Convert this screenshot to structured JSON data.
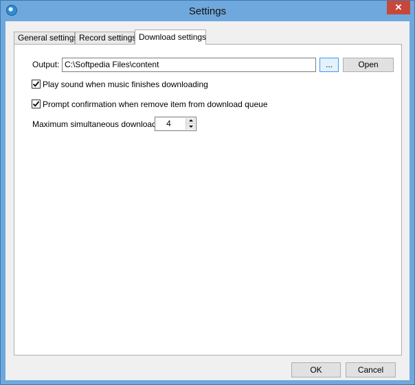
{
  "window": {
    "title": "Settings",
    "close_symbol": "✕",
    "app_icon": "app-logo-icon"
  },
  "tabs": [
    {
      "label": "General settings",
      "active": false
    },
    {
      "label": "Record settings",
      "active": false
    },
    {
      "label": "Download settings",
      "active": true
    }
  ],
  "download": {
    "output_label": "Output:",
    "output_value": "C:\\Softpedia Files\\content",
    "browse_label": "...",
    "open_label": "Open",
    "play_sound": {
      "label": "Play sound when music finishes downloading",
      "checked": true
    },
    "prompt_confirm": {
      "label": "Prompt confirmation when remove item from download queue",
      "checked": true
    },
    "max_downloads_label": "Maximum simultaneous downloads:",
    "max_downloads_value": "4"
  },
  "footer": {
    "ok_label": "OK",
    "cancel_label": "Cancel"
  },
  "colors": {
    "window_frame": "#6fa8dc",
    "close_button": "#c7483b",
    "focus_border": "#3399ff"
  }
}
